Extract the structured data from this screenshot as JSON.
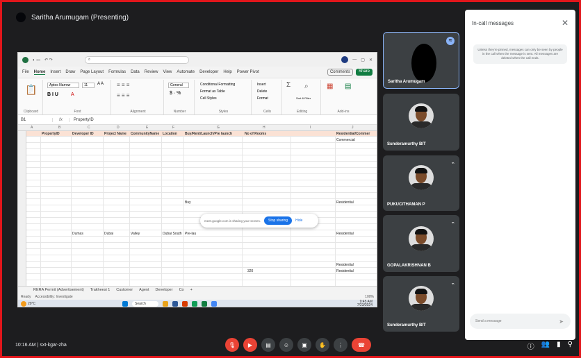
{
  "meet": {
    "presenter_label": "Saritha Arumugam (Presenting)",
    "time": "10:16 AM",
    "separator": "|",
    "meeting_code": "sxt-kgar-zha",
    "participants": [
      {
        "name": "Saritha Arumugam",
        "muted": false,
        "speaking": true
      },
      {
        "name": "Sunderamurthy BIT",
        "muted": false
      },
      {
        "name": "PUKUCITHAMAN P",
        "muted": true
      },
      {
        "name": "GOPALAKRISHNAN B",
        "muted": true
      },
      {
        "name": "Sunderamurthy BIT",
        "muted": true
      }
    ],
    "chat": {
      "title": "In-call messages",
      "info": "Unless they're pinned, messages can only be seen by people in the call when the message is sent. All messages are deleted when the call ends.",
      "placeholder": "Send a message"
    },
    "screen_share_bar": {
      "text": "meet.google.com is sharing your screen.",
      "stop": "Stop sharing",
      "hide": "Hide"
    }
  },
  "excel": {
    "menu": [
      "File",
      "Home",
      "Insert",
      "Draw",
      "Page Layout",
      "Formulas",
      "Data",
      "Review",
      "View",
      "Automate",
      "Developer",
      "Help",
      "Power Pivot"
    ],
    "comments": "Comments",
    "share": "Share",
    "font_name": "Aptos Narrow",
    "font_size": "11",
    "number_format": "General",
    "ribbon_groups": [
      "Clipboard",
      "Font",
      "Alignment",
      "Number",
      "Styles",
      "Cells",
      "Editing",
      "Add-ins"
    ],
    "ribbon_items": [
      "Conditional Formatting",
      "Format as Table",
      "Cell Styles",
      "Insert",
      "Delete",
      "Format",
      "Sort & Filter",
      "Find & Select",
      "Add-ins",
      "Analyze Data"
    ],
    "name_box": "B1",
    "formula": "PropertyID",
    "columns": [
      "A",
      "B",
      "C",
      "D",
      "E",
      "F",
      "G",
      "H",
      "I",
      "J"
    ],
    "headers": [
      "PropertyID",
      "Developer ID",
      "Project Name",
      "CommunityName",
      "Location",
      "Buy/Rent/Launch/Pre launch",
      "No of Rooms",
      "Residential/Commer"
    ],
    "rows": [
      {
        "row": 1,
        "cells": {
          "J": "Commercial"
        }
      },
      {
        "row": 6,
        "cells": {
          "F": "Buy",
          "J": "Residential"
        }
      },
      {
        "row": 10,
        "cells": {
          "B": "Dumas",
          "C": "Dubai",
          "D": "Valley",
          "E": "Dubai South",
          "F": "Pre-lau",
          "J": "Residential"
        }
      },
      {
        "row": 16,
        "cells": {
          "J": "Residential"
        }
      },
      {
        "row": 17,
        "cells": {
          "H": "320",
          "J": "Residential"
        }
      }
    ],
    "sheets": [
      "RERA Permit (Advertisement)",
      "Trakheesi 1",
      "Customer",
      "Agent",
      "Developer",
      "Co"
    ],
    "status": [
      "Ready",
      "Accessibility: Investigate"
    ],
    "zoom": "100%",
    "taskbar_search": "Search",
    "weather": "29°C",
    "clock_time": "9:45 AM",
    "clock_date": "7/23/2024"
  }
}
